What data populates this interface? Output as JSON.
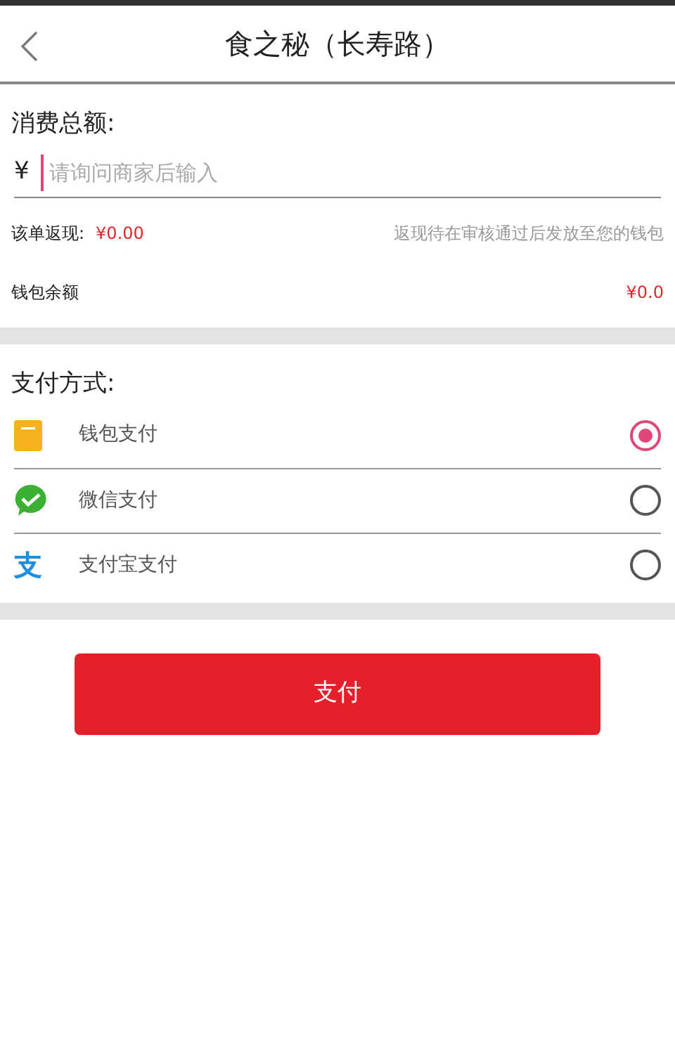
{
  "header": {
    "title": "食之秘（长寿路）"
  },
  "amount": {
    "label": "消费总额:",
    "currency": "¥",
    "placeholder": "请询问商家后输入"
  },
  "cashback": {
    "label": "该单返现:",
    "value": "¥0.00",
    "note": "返现待在审核通过后发放至您的钱包"
  },
  "wallet_balance": {
    "label": "钱包余额",
    "value": "¥0.0"
  },
  "payment": {
    "label": "支付方式:",
    "methods": [
      {
        "kind": "wallet",
        "name": "钱包支付",
        "selected": true
      },
      {
        "kind": "wechat",
        "name": "微信支付",
        "selected": false
      },
      {
        "kind": "alipay",
        "icon_text": "支",
        "name": "支付宝支付",
        "selected": false
      }
    ]
  },
  "pay_button": "支付"
}
